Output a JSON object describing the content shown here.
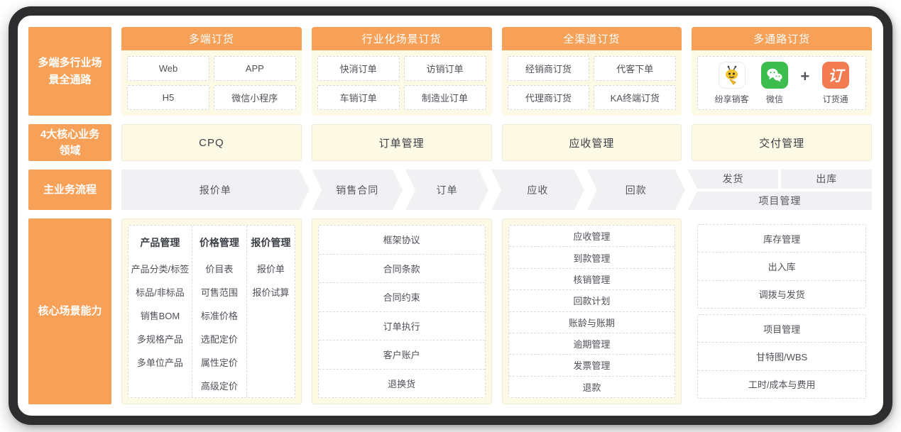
{
  "rail": {
    "row1": "多端多行业场景全通路",
    "row2": "4大核心业务领域",
    "row3": "主业务流程",
    "row4": "核心场景能力"
  },
  "channels": [
    {
      "title": "多端订货",
      "items": [
        "Web",
        "APP",
        "H5",
        "微信小程序"
      ]
    },
    {
      "title": "行业化场景订货",
      "items": [
        "快消订单",
        "访销订单",
        "车销订单",
        "制造业订单"
      ]
    },
    {
      "title": "全渠道订货",
      "items": [
        "经销商订货",
        "代客下单",
        "代理商订货",
        "KA终端订货"
      ]
    },
    {
      "title": "多通路订货",
      "apps": [
        {
          "name": "纷享销客",
          "icon": "fxiaoke-bee-icon"
        },
        {
          "name": "微信",
          "icon": "wechat-icon"
        },
        {
          "name": "订货通",
          "icon": "dinghuotong-icon",
          "glyph": "订"
        }
      ],
      "plus": "+"
    }
  ],
  "domains": [
    "CPQ",
    "订单管理",
    "应收管理",
    "交付管理"
  ],
  "flow": {
    "steps": [
      "报价单",
      "销售合同",
      "订单",
      "应收",
      "回款"
    ],
    "last_group": {
      "top": [
        "发货",
        "出库"
      ],
      "bottom": "项目管理"
    }
  },
  "capabilities": {
    "cpq_columns": [
      {
        "header": "产品管理",
        "items": [
          "产品分类/标签",
          "标品/非标品",
          "销售BOM",
          "多规格产品",
          "多单位产品"
        ]
      },
      {
        "header": "价格管理",
        "items": [
          "价目表",
          "可售范围",
          "标准价格",
          "选配定价",
          "属性定价",
          "高级定价"
        ]
      },
      {
        "header": "报价管理",
        "items": [
          "报价单",
          "报价试算"
        ]
      }
    ],
    "order": [
      "框架协议",
      "合同条款",
      "合同约束",
      "订单执行",
      "客户账户",
      "退换货"
    ],
    "receivable": [
      "应收管理",
      "到款管理",
      "核销管理",
      "回款计划",
      "账龄与账期",
      "逾期管理",
      "发票管理",
      "退款"
    ],
    "delivery": {
      "group1": [
        "库存管理",
        "出入库",
        "调拨与发货"
      ],
      "group2": [
        "项目管理",
        "甘特图/WBS",
        "工时/成本与费用"
      ]
    }
  },
  "colors": {
    "accent_orange": "#F7A158",
    "cream": "#FCF9E5",
    "flow_gray": "#F1F1F3",
    "wechat_green": "#3CBD4D",
    "dinghuotong_orange": "#F27B52",
    "frame_dark": "#2e2e30"
  }
}
